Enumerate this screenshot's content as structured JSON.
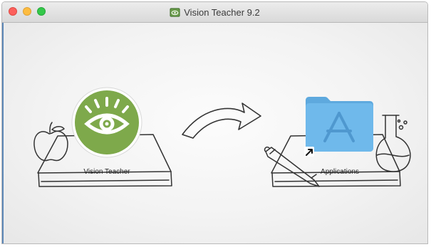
{
  "window": {
    "title": "Vision Teacher 9.2",
    "title_icon": "vision-teacher-app-icon"
  },
  "titlebar": {
    "buttons": [
      "close",
      "minimize",
      "zoom"
    ],
    "colors": {
      "close": "#fc605c",
      "minimize": "#fdbc40",
      "zoom": "#34c84a"
    }
  },
  "installer": {
    "app_label": "Vision Teacher",
    "app_icon": "eye-icon",
    "app_icon_color": "#7ea94b",
    "arrow_icon": "hand-drawn-arrow-icon",
    "target_label": "Applications",
    "target_icon": "applications-folder-icon",
    "folder_color": "#6fb9eb",
    "alias_badge": "alias-arrow-icon"
  }
}
